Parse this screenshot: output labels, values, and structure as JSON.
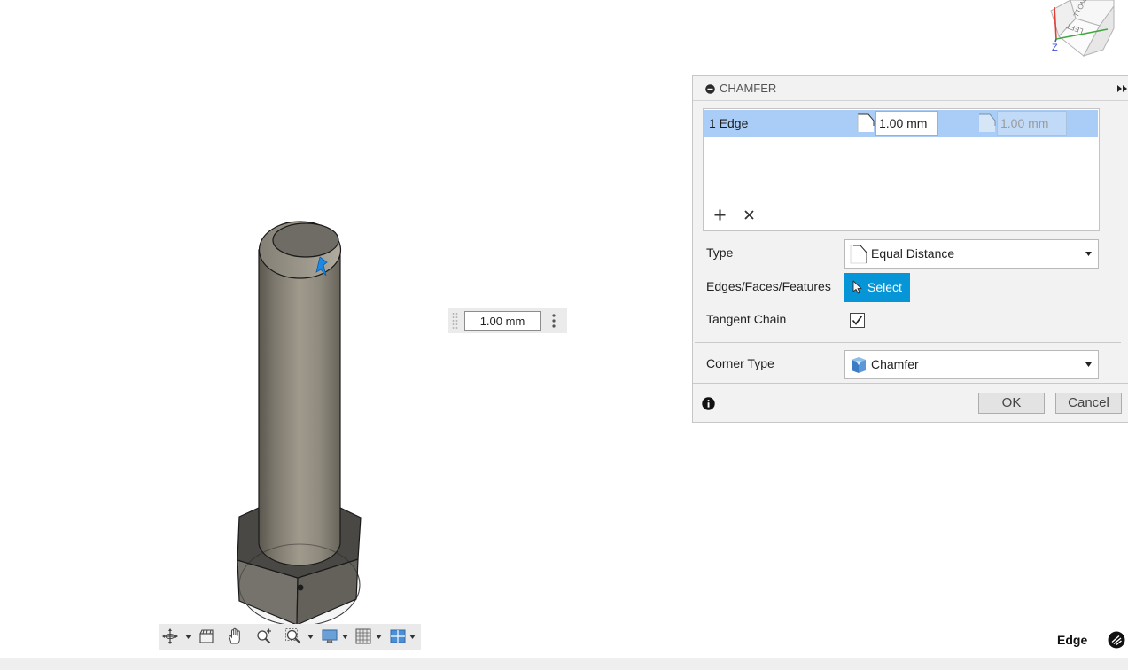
{
  "app": {
    "accent": "#0696d7",
    "selection_highlight": "#a9cdf6"
  },
  "viewcube": {
    "faces": {
      "bottom": "TTOM",
      "left": "LEFT"
    },
    "axis_label": "Z",
    "axis_colors": {
      "x": "#e53935",
      "y": "#3da83d",
      "z": "#3f51d8"
    }
  },
  "chamfer_dialog": {
    "title": "CHAMFER",
    "header_icon": "collapse-minus-icon",
    "expand_icon": "double-chevron-right-icon",
    "edge_sets": [
      {
        "label": "1 Edge",
        "distance": "1.00 mm",
        "distance2": "1.00 mm",
        "distance2_enabled": false,
        "selected": true
      }
    ],
    "list_actions": [
      "add-icon",
      "remove-icon"
    ],
    "type": {
      "label": "Type",
      "value": "Equal Distance",
      "icon": "equal-distance-icon"
    },
    "selection": {
      "label": "Edges/Faces/Features",
      "button": "Select",
      "icon": "cursor-icon"
    },
    "tangent_chain": {
      "label": "Tangent Chain",
      "checked": true
    },
    "corner_type": {
      "label": "Corner Type",
      "value": "Chamfer",
      "icon": "chamfer-corner-icon"
    },
    "footer": {
      "info_icon": "info-icon",
      "ok": "OK",
      "cancel": "Cancel"
    }
  },
  "canvas_input": {
    "value": "1.00 mm",
    "grip_icon": "grip-icon",
    "menu_icon": "more-vertical-icon"
  },
  "nav_toolbar": {
    "tools": [
      "orbit-icon",
      "look-at-icon",
      "pan-icon",
      "zoom-window-icon",
      "zoom-icon",
      "display-settings-icon",
      "grid-icon",
      "viewports-icon"
    ]
  },
  "status": {
    "selection_filter": "Edge",
    "icon": "feedback-icon"
  }
}
